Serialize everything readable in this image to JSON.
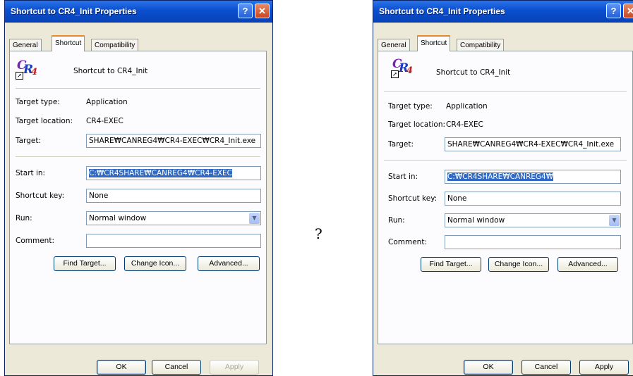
{
  "separator_text": "?",
  "dialogs": [
    {
      "title": "Shortcut to CR4_Init Properties",
      "tabs": [
        "General",
        "Shortcut",
        "Compatibility"
      ],
      "shortcut_name": "Shortcut to CR4_Init",
      "target_type_label": "Target type:",
      "target_type_value": "Application",
      "target_location_label": "Target location:",
      "target_location_value": "CR4-EXEC",
      "target_label": "Target:",
      "target_value": "SHARE₩CANREG4₩CR4-EXEC₩CR4_Init.exe",
      "start_in_label": "Start in:",
      "start_in_value": "C:₩CR4SHARE₩CANREG4₩CR4-EXEC",
      "shortcut_key_label": "Shortcut key:",
      "shortcut_key_value": "None",
      "run_label": "Run:",
      "run_value": "Normal window",
      "comment_label": "Comment:",
      "comment_value": "",
      "find_target_label": "Find Target...",
      "change_icon_label": "Change Icon...",
      "advanced_label": "Advanced...",
      "ok_label": "OK",
      "cancel_label": "Cancel",
      "apply_label": "Apply",
      "apply_enabled": false
    },
    {
      "title": "Shortcut to CR4_Init Properties",
      "tabs": [
        "General",
        "Shortcut",
        "Compatibility"
      ],
      "shortcut_name": "Shortcut to CR4_Init",
      "target_type_label": "Target type:",
      "target_type_value": "Application",
      "target_location_label": "Target location:",
      "target_location_value": "CR4-EXEC",
      "target_label": "Target:",
      "target_value": "SHARE₩CANREG4₩CR4-EXEC₩CR4_Init.exe",
      "start_in_label": "Start in:",
      "start_in_value": "C:₩CR4SHARE₩CANREG4₩",
      "shortcut_key_label": "Shortcut key:",
      "shortcut_key_value": "None",
      "run_label": "Run:",
      "run_value": "Normal window",
      "comment_label": "Comment:",
      "comment_value": "",
      "find_target_label": "Find Target...",
      "change_icon_label": "Change Icon...",
      "advanced_label": "Advanced...",
      "ok_label": "OK",
      "cancel_label": "Cancel",
      "apply_label": "Apply",
      "apply_enabled": true
    }
  ]
}
